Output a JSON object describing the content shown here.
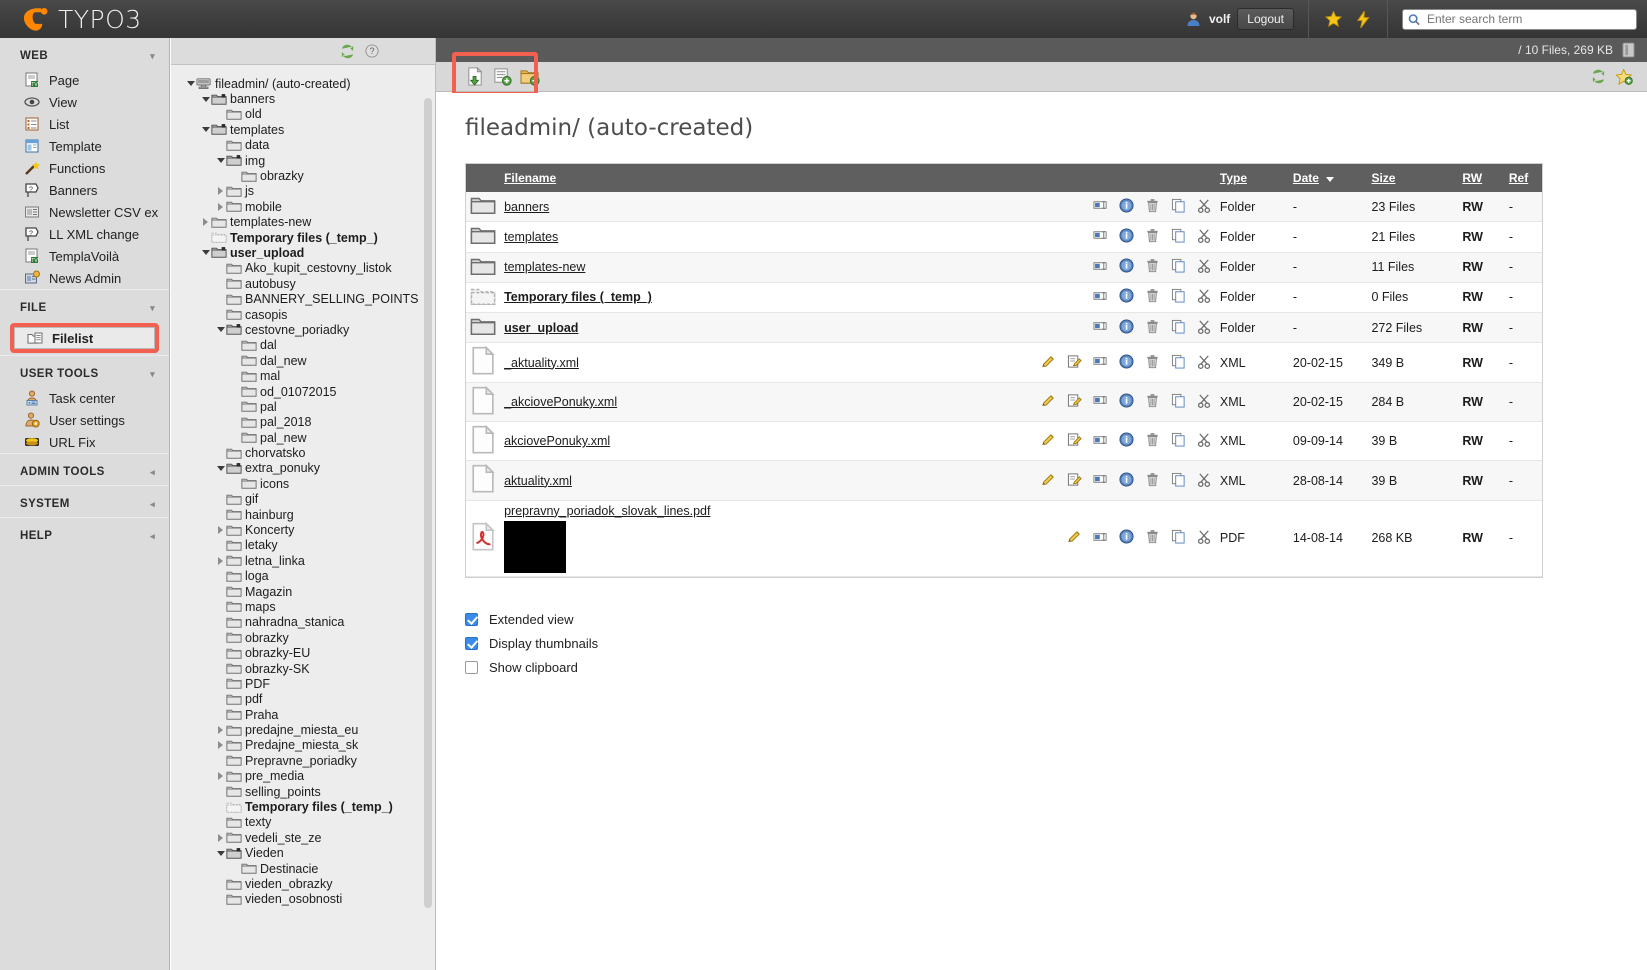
{
  "app": {
    "brand": "TYPO3",
    "user_name": "volf",
    "logout_label": "Logout",
    "search_placeholder": "Enter search term",
    "accent_red": "#e00000",
    "highlight_red": "#f4604f"
  },
  "modmenu": {
    "sections": [
      {
        "title": "WEB",
        "collapsed": false,
        "items": [
          {
            "label": "Page",
            "icon": "page-icon"
          },
          {
            "label": "View",
            "icon": "eye-icon"
          },
          {
            "label": "List",
            "icon": "list-icon"
          },
          {
            "label": "Template",
            "icon": "template-icon"
          },
          {
            "label": "Functions",
            "icon": "wand-icon"
          },
          {
            "label": "Banners",
            "icon": "banners-icon"
          },
          {
            "label": "Newsletter CSV expor",
            "icon": "csv-icon"
          },
          {
            "label": "LL XML change",
            "icon": "xml-icon"
          },
          {
            "label": "TemplaVoilà",
            "icon": "templavoila-icon"
          },
          {
            "label": "News Admin",
            "icon": "news-icon"
          }
        ]
      },
      {
        "title": "FILE",
        "collapsed": false,
        "items": [
          {
            "label": "Filelist",
            "icon": "filelist-icon",
            "active": true,
            "highlighted": true
          }
        ]
      },
      {
        "title": "USER TOOLS",
        "collapsed": false,
        "items": [
          {
            "label": "Task center",
            "icon": "task-center-icon"
          },
          {
            "label": "User settings",
            "icon": "user-settings-icon"
          },
          {
            "label": "URL Fix",
            "icon": "url-fix-icon"
          }
        ]
      },
      {
        "title": "ADMIN TOOLS",
        "collapsed": true,
        "items": []
      },
      {
        "title": "SYSTEM",
        "collapsed": true,
        "items": []
      },
      {
        "title": "HELP",
        "collapsed": true,
        "items": []
      }
    ]
  },
  "tree": {
    "nodes": [
      {
        "label": "fileadmin/ (auto-created)",
        "depth": 0,
        "toggle": "down",
        "icon": "mount-icon",
        "bold": false
      },
      {
        "label": "banners",
        "depth": 1,
        "toggle": "down",
        "icon": "folder-open-icon",
        "bold": false
      },
      {
        "label": "old",
        "depth": 2,
        "toggle": "none",
        "icon": "folder-icon",
        "bold": false
      },
      {
        "label": "templates",
        "depth": 1,
        "toggle": "down",
        "icon": "folder-open-icon",
        "bold": false
      },
      {
        "label": "data",
        "depth": 2,
        "toggle": "none",
        "icon": "folder-icon",
        "bold": false
      },
      {
        "label": "img",
        "depth": 2,
        "toggle": "down",
        "icon": "folder-open-icon",
        "bold": false
      },
      {
        "label": "obrazky",
        "depth": 3,
        "toggle": "none",
        "icon": "folder-icon",
        "bold": false
      },
      {
        "label": "js",
        "depth": 2,
        "toggle": "right",
        "icon": "folder-icon",
        "bold": false
      },
      {
        "label": "mobile",
        "depth": 2,
        "toggle": "right",
        "icon": "folder-icon",
        "bold": false
      },
      {
        "label": "templates-new",
        "depth": 1,
        "toggle": "right",
        "icon": "folder-icon",
        "bold": false
      },
      {
        "label": "Temporary files (_temp_)",
        "depth": 1,
        "toggle": "none",
        "icon": "temp-folder-icon",
        "bold": true
      },
      {
        "label": "user_upload",
        "depth": 1,
        "toggle": "down",
        "icon": "folder-open-icon",
        "bold": true
      },
      {
        "label": "Ako_kupit_cestovny_listok",
        "depth": 2,
        "toggle": "none",
        "icon": "folder-icon",
        "bold": false
      },
      {
        "label": "autobusy",
        "depth": 2,
        "toggle": "none",
        "icon": "folder-icon",
        "bold": false
      },
      {
        "label": "BANNERY_SELLING_POINTS",
        "depth": 2,
        "toggle": "none",
        "icon": "folder-icon",
        "bold": false
      },
      {
        "label": "casopis",
        "depth": 2,
        "toggle": "none",
        "icon": "folder-icon",
        "bold": false
      },
      {
        "label": "cestovne_poriadky",
        "depth": 2,
        "toggle": "down",
        "icon": "folder-open-icon",
        "bold": false
      },
      {
        "label": "dal",
        "depth": 3,
        "toggle": "none",
        "icon": "folder-icon",
        "bold": false
      },
      {
        "label": "dal_new",
        "depth": 3,
        "toggle": "none",
        "icon": "folder-icon",
        "bold": false
      },
      {
        "label": "mal",
        "depth": 3,
        "toggle": "none",
        "icon": "folder-icon",
        "bold": false
      },
      {
        "label": "od_01072015",
        "depth": 3,
        "toggle": "none",
        "icon": "folder-icon",
        "bold": false
      },
      {
        "label": "pal",
        "depth": 3,
        "toggle": "none",
        "icon": "folder-icon",
        "bold": false
      },
      {
        "label": "pal_2018",
        "depth": 3,
        "toggle": "none",
        "icon": "folder-icon",
        "bold": false
      },
      {
        "label": "pal_new",
        "depth": 3,
        "toggle": "none",
        "icon": "folder-icon",
        "bold": false
      },
      {
        "label": "chorvatsko",
        "depth": 2,
        "toggle": "none",
        "icon": "folder-icon",
        "bold": false
      },
      {
        "label": "extra_ponuky",
        "depth": 2,
        "toggle": "down",
        "icon": "folder-open-icon",
        "bold": false
      },
      {
        "label": "icons",
        "depth": 3,
        "toggle": "none",
        "icon": "folder-icon",
        "bold": false
      },
      {
        "label": "gif",
        "depth": 2,
        "toggle": "none",
        "icon": "folder-icon",
        "bold": false
      },
      {
        "label": "hainburg",
        "depth": 2,
        "toggle": "none",
        "icon": "folder-icon",
        "bold": false
      },
      {
        "label": "Koncerty",
        "depth": 2,
        "toggle": "right",
        "icon": "folder-icon",
        "bold": false
      },
      {
        "label": "letaky",
        "depth": 2,
        "toggle": "none",
        "icon": "folder-icon",
        "bold": false
      },
      {
        "label": "letna_linka",
        "depth": 2,
        "toggle": "right",
        "icon": "folder-icon",
        "bold": false
      },
      {
        "label": "loga",
        "depth": 2,
        "toggle": "none",
        "icon": "folder-icon",
        "bold": false
      },
      {
        "label": "Magazin",
        "depth": 2,
        "toggle": "none",
        "icon": "folder-icon",
        "bold": false
      },
      {
        "label": "maps",
        "depth": 2,
        "toggle": "none",
        "icon": "folder-icon",
        "bold": false
      },
      {
        "label": "nahradna_stanica",
        "depth": 2,
        "toggle": "none",
        "icon": "folder-icon",
        "bold": false
      },
      {
        "label": "obrazky",
        "depth": 2,
        "toggle": "none",
        "icon": "folder-icon",
        "bold": false
      },
      {
        "label": "obrazky-EU",
        "depth": 2,
        "toggle": "none",
        "icon": "folder-icon",
        "bold": false
      },
      {
        "label": "obrazky-SK",
        "depth": 2,
        "toggle": "none",
        "icon": "folder-icon",
        "bold": false
      },
      {
        "label": "PDF",
        "depth": 2,
        "toggle": "none",
        "icon": "folder-icon",
        "bold": false
      },
      {
        "label": "pdf",
        "depth": 2,
        "toggle": "none",
        "icon": "folder-icon",
        "bold": false
      },
      {
        "label": "Praha",
        "depth": 2,
        "toggle": "none",
        "icon": "folder-icon",
        "bold": false
      },
      {
        "label": "predajne_miesta_eu",
        "depth": 2,
        "toggle": "right",
        "icon": "folder-icon",
        "bold": false
      },
      {
        "label": "Predajne_miesta_sk",
        "depth": 2,
        "toggle": "right",
        "icon": "folder-icon",
        "bold": false
      },
      {
        "label": "Prepravne_poriadky",
        "depth": 2,
        "toggle": "none",
        "icon": "folder-icon",
        "bold": false
      },
      {
        "label": "pre_media",
        "depth": 2,
        "toggle": "right",
        "icon": "folder-icon",
        "bold": false
      },
      {
        "label": "selling_points",
        "depth": 2,
        "toggle": "none",
        "icon": "folder-icon",
        "bold": false
      },
      {
        "label": "Temporary files (_temp_)",
        "depth": 2,
        "toggle": "none",
        "icon": "temp-folder-icon",
        "bold": true
      },
      {
        "label": "texty",
        "depth": 2,
        "toggle": "none",
        "icon": "folder-icon",
        "bold": false
      },
      {
        "label": "vedeli_ste_ze",
        "depth": 2,
        "toggle": "right",
        "icon": "folder-icon",
        "bold": false
      },
      {
        "label": "Vieden",
        "depth": 2,
        "toggle": "down",
        "icon": "folder-open-icon",
        "bold": false
      },
      {
        "label": "Destinacie",
        "depth": 3,
        "toggle": "none",
        "icon": "folder-icon",
        "bold": false
      },
      {
        "label": "vieden_obrazky",
        "depth": 2,
        "toggle": "none",
        "icon": "folder-icon",
        "bold": false
      },
      {
        "label": "vieden_osobnosti",
        "depth": 2,
        "toggle": "none",
        "icon": "folder-icon",
        "bold": false
      }
    ]
  },
  "main": {
    "status_text": "/ 10 Files, 269 KB",
    "page_title": "fileadmin/ (auto-created)",
    "toolbar_icons": [
      {
        "name": "create-file-icon"
      },
      {
        "name": "create-text-file-icon"
      },
      {
        "name": "create-folder-icon"
      }
    ],
    "columns": [
      {
        "key": "filename",
        "label": "Filename",
        "sorted": false
      },
      {
        "key": "type",
        "label": "Type",
        "sorted": false
      },
      {
        "key": "date",
        "label": "Date",
        "sorted": true,
        "sort_dir": "desc"
      },
      {
        "key": "size",
        "label": "Size",
        "sorted": false
      },
      {
        "key": "rw",
        "label": "RW",
        "sorted": false
      },
      {
        "key": "ref",
        "label": "Ref",
        "sorted": false
      }
    ],
    "rows": [
      {
        "icon": "folder-icon",
        "name": "banners",
        "bold": false,
        "actions": [
          "rename",
          "info",
          "delete",
          "copy",
          "cut"
        ],
        "type": "Folder",
        "date": "-",
        "size": "23 Files",
        "rw": "RW",
        "ref": "-",
        "thumb": false
      },
      {
        "icon": "folder-icon",
        "name": "templates",
        "bold": false,
        "actions": [
          "rename",
          "info",
          "delete",
          "copy",
          "cut"
        ],
        "type": "Folder",
        "date": "-",
        "size": "21 Files",
        "rw": "RW",
        "ref": "-",
        "thumb": false
      },
      {
        "icon": "folder-icon",
        "name": "templates-new",
        "bold": false,
        "actions": [
          "rename",
          "info",
          "delete",
          "copy",
          "cut"
        ],
        "type": "Folder",
        "date": "-",
        "size": "11 Files",
        "rw": "RW",
        "ref": "-",
        "thumb": false
      },
      {
        "icon": "temp-folder-icon",
        "name": "Temporary files (_temp_)",
        "bold": true,
        "actions": [
          "rename",
          "info",
          "delete",
          "copy",
          "cut"
        ],
        "type": "Folder",
        "date": "-",
        "size": "0 Files",
        "rw": "RW",
        "ref": "-",
        "thumb": false
      },
      {
        "icon": "folder-icon",
        "name": "user_upload",
        "bold": true,
        "actions": [
          "rename",
          "info",
          "delete",
          "copy",
          "cut"
        ],
        "type": "Folder",
        "date": "-",
        "size": "272 Files",
        "rw": "RW",
        "ref": "-",
        "thumb": false
      },
      {
        "icon": "file-icon",
        "name": "_aktuality.xml",
        "bold": false,
        "actions": [
          "edit",
          "edit-meta",
          "rename",
          "info",
          "delete",
          "copy",
          "cut"
        ],
        "type": "XML",
        "date": "20-02-15",
        "size": "349 B",
        "rw": "RW",
        "ref": "-",
        "thumb": false
      },
      {
        "icon": "file-icon",
        "name": "_akciovePonuky.xml",
        "bold": false,
        "actions": [
          "edit",
          "edit-meta",
          "rename",
          "info",
          "delete",
          "copy",
          "cut"
        ],
        "type": "XML",
        "date": "20-02-15",
        "size": "284 B",
        "rw": "RW",
        "ref": "-",
        "thumb": false
      },
      {
        "icon": "file-icon",
        "name": "akciovePonuky.xml",
        "bold": false,
        "actions": [
          "edit",
          "edit-meta",
          "rename",
          "info",
          "delete",
          "copy",
          "cut"
        ],
        "type": "XML",
        "date": "09-09-14",
        "size": "39 B",
        "rw": "RW",
        "ref": "-",
        "thumb": false
      },
      {
        "icon": "file-icon",
        "name": "aktuality.xml",
        "bold": false,
        "actions": [
          "edit",
          "edit-meta",
          "rename",
          "info",
          "delete",
          "copy",
          "cut"
        ],
        "type": "XML",
        "date": "28-08-14",
        "size": "39 B",
        "rw": "RW",
        "ref": "-",
        "thumb": false
      },
      {
        "icon": "pdf-icon",
        "name": "prepravny_poriadok_slovak_lines.pdf",
        "bold": false,
        "actions": [
          "edit",
          "rename",
          "info",
          "delete",
          "copy",
          "cut"
        ],
        "type": "PDF",
        "date": "14-08-14",
        "size": "268 KB",
        "rw": "RW",
        "ref": "-",
        "thumb": true
      }
    ],
    "checkboxes": [
      {
        "label": "Extended view",
        "checked": true
      },
      {
        "label": "Display thumbnails",
        "checked": true
      },
      {
        "label": "Show clipboard",
        "checked": false
      }
    ]
  }
}
